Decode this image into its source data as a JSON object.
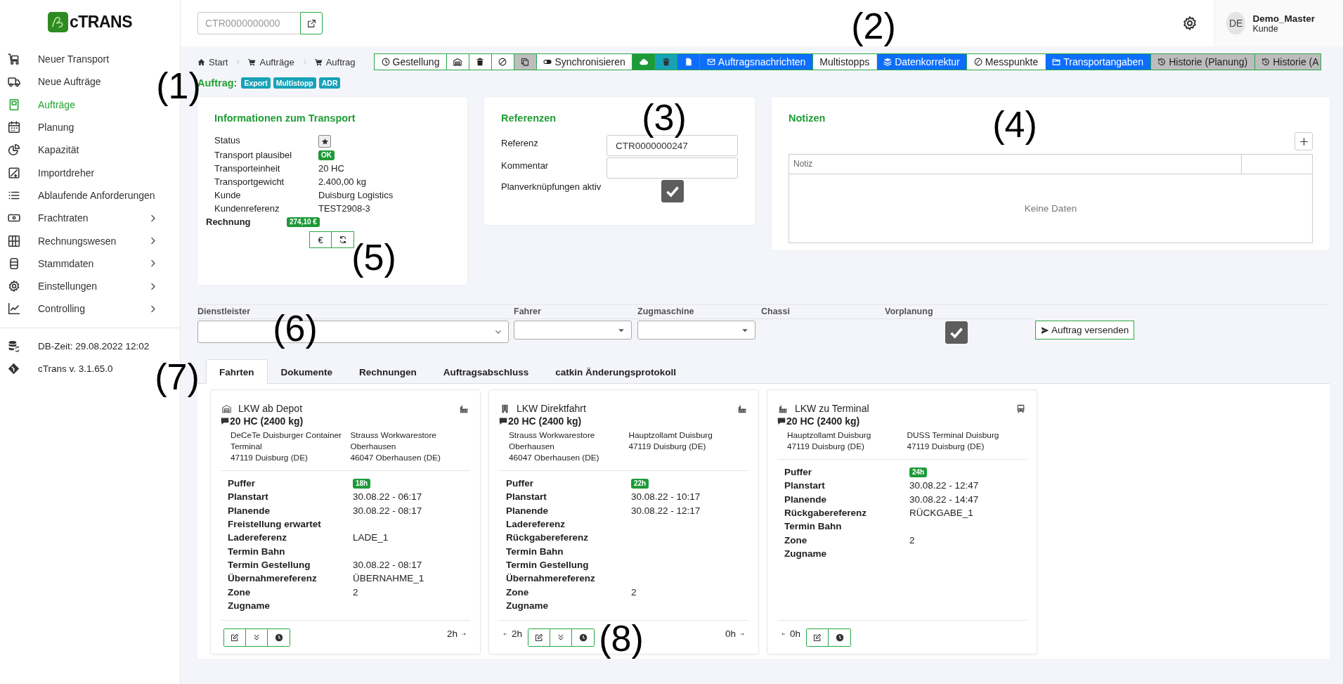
{
  "sidebar": {
    "logo": "cTRANS",
    "items": [
      {
        "label": "Neuer Transport",
        "selected": false,
        "submenu": false
      },
      {
        "label": "Neue Aufträge",
        "selected": false,
        "submenu": false
      },
      {
        "label": "Aufträge",
        "selected": true,
        "submenu": false
      },
      {
        "label": "Planung",
        "selected": false,
        "submenu": false
      },
      {
        "label": "Kapazität",
        "selected": false,
        "submenu": false
      },
      {
        "label": "Importdreher",
        "selected": false,
        "submenu": false
      },
      {
        "label": "Ablaufende Anforderungen",
        "selected": false,
        "submenu": false
      },
      {
        "label": "Frachtraten",
        "selected": false,
        "submenu": true
      },
      {
        "label": "Rechnungswesen",
        "selected": false,
        "submenu": true
      },
      {
        "label": "Stammdaten",
        "selected": false,
        "submenu": true
      },
      {
        "label": "Einstellungen",
        "selected": false,
        "submenu": true
      },
      {
        "label": "Controlling",
        "selected": false,
        "submenu": true
      }
    ],
    "footer": [
      "DB-Zeit: 29.08.2022 12:02",
      "cTrans v. 3.1.65.0"
    ]
  },
  "header": {
    "search": {
      "placeholder": "CTR0000000000"
    },
    "user": {
      "initials": "DE",
      "name": "Demo_Master",
      "role": "Kunde"
    }
  },
  "breadcrumb": [
    "Start",
    "Aufträge",
    "Auftrag"
  ],
  "toolbar": [
    {
      "label": "Gestellung",
      "kind": "outline"
    },
    {
      "kind": "outline"
    },
    {
      "kind": "outline"
    },
    {
      "kind": "outline"
    },
    {
      "kind": "gray"
    },
    {
      "label": "Synchronisieren",
      "kind": "outline"
    },
    {
      "kind": "green"
    },
    {
      "kind": "teal"
    },
    {
      "kind": "blue"
    },
    {
      "label": "Auftragsnachrichten",
      "kind": "blue"
    },
    {
      "label": "Multistopps",
      "kind": "plain"
    },
    {
      "label": "Datenkorrektur",
      "kind": "blue"
    },
    {
      "label": "Messpunkte",
      "kind": "plain"
    },
    {
      "label": "Transportangaben",
      "kind": "blue"
    },
    {
      "label": "Historie (Planung)",
      "kind": "gray"
    },
    {
      "label": "Historie (A",
      "kind": "gray"
    }
  ],
  "order": {
    "title": "Auftrag:",
    "tags": [
      "Export",
      "Multistopp",
      "ADR"
    ]
  },
  "transport_info": {
    "title": "Informationen zum Transport",
    "rows": [
      {
        "label": "Status",
        "kind": "star"
      },
      {
        "label": "Transport plausibel",
        "kind": "badge",
        "value": "OK"
      },
      {
        "label": "Transporteinheit",
        "kind": "text",
        "value": "20 HC"
      },
      {
        "label": "Transportgewicht",
        "kind": "text",
        "value": "2.400,00 kg"
      },
      {
        "label": "Kunde",
        "kind": "text",
        "value": "Duisburg Logistics"
      },
      {
        "label": "Kundenreferenz",
        "kind": "text",
        "value": "TEST2908-3"
      }
    ],
    "invoice": {
      "label": "Rechnung",
      "badge": "274,10 €",
      "currency_button": "€"
    }
  },
  "references": {
    "title": "Referenzen",
    "fields": [
      {
        "label": "Referenz",
        "value": "CTR0000000247"
      },
      {
        "label": "Kommentar"
      }
    ],
    "plan_links": {
      "label": "Planverknüpfungen aktiv",
      "checked": true
    }
  },
  "notes": {
    "title": "Notizen",
    "columns": [
      "Notiz"
    ],
    "empty_text": "Keine Daten"
  },
  "assignment": {
    "fields": [
      {
        "label": "Dienstleister",
        "kind": "wide-select"
      },
      {
        "label": "Fahrer",
        "kind": "select"
      },
      {
        "label": "Zugmaschine",
        "kind": "select"
      },
      {
        "label": "Chassi",
        "kind": "none"
      },
      {
        "label": "Vorplanung",
        "kind": "checkbox",
        "checked": true
      }
    ],
    "send_button": "Auftrag versenden"
  },
  "tabs": [
    {
      "label": "Fahrten",
      "selected": true
    },
    {
      "label": "Dokumente",
      "selected": false
    },
    {
      "label": "Rechnungen",
      "selected": false
    },
    {
      "label": "Auftragsabschluss",
      "selected": false
    },
    {
      "label": "catkin Änderungsprotokoll",
      "selected": false
    }
  ],
  "trips": [
    {
      "title": "LKW ab Depot",
      "cargo": "20 HC (2400 kg)",
      "from": {
        "name": "DeCeTe Duisburger Container Terminal",
        "city": "47119 Duisburg (DE)"
      },
      "to": {
        "name": "Strauss Workwarestore Oberhausen",
        "city": "46047 Oberhausen (DE)"
      },
      "details": [
        {
          "label": "Puffer",
          "badge": "18h"
        },
        {
          "label": "Planstart",
          "value": "30.08.22 - 06:17"
        },
        {
          "label": "Planende",
          "value": "30.08.22 - 08:17"
        },
        {
          "label": "Freistellung erwartet"
        },
        {
          "label": "Ladereferenz",
          "value": "LADE_1"
        },
        {
          "label": "Termin Bahn"
        },
        {
          "label": "Termin Gestellung",
          "value": "30.08.22 - 08:17"
        },
        {
          "label": "Übernahmereferenz",
          "value": "ÜBERNAHME_1"
        },
        {
          "label": "Zone",
          "value": "2"
        },
        {
          "label": "Zugname"
        }
      ],
      "footer": {
        "actions": [
          {
            "kind": "edit"
          },
          {
            "kind": "expand"
          },
          {
            "kind": "clock"
          }
        ],
        "next_duration": "2h"
      }
    },
    {
      "title": "LKW Direktfahrt",
      "cargo": "20 HC (2400 kg)",
      "from": {
        "name": "Strauss Workwarestore Oberhausen",
        "city": "46047 Oberhausen (DE)"
      },
      "to": {
        "name": "Hauptzollamt Duisburg",
        "city": "47119 Duisburg (DE)"
      },
      "details": [
        {
          "label": "Puffer",
          "badge": "22h"
        },
        {
          "label": "Planstart",
          "value": "30.08.22 - 10:17"
        },
        {
          "label": "Planende",
          "value": "30.08.22 - 12:17"
        },
        {
          "label": "Ladereferenz"
        },
        {
          "label": "Rückgabereferenz"
        },
        {
          "label": "Termin Bahn"
        },
        {
          "label": "Termin Gestellung"
        },
        {
          "label": "Übernahmereferenz"
        },
        {
          "label": "Zone",
          "value": "2"
        },
        {
          "label": "Zugname"
        }
      ],
      "footer": {
        "prev_duration": "2h",
        "actions": [
          {
            "kind": "edit"
          },
          {
            "kind": "expand"
          },
          {
            "kind": "clock"
          }
        ],
        "next_duration": "0h"
      }
    },
    {
      "title": "LKW zu Terminal",
      "cargo": "20 HC (2400 kg)",
      "from": {
        "name": "Hauptzollamt Duisburg",
        "city": "47119 Duisburg (DE)"
      },
      "to": {
        "name": "DUSS Terminal Duisburg",
        "city": "47119 Duisburg (DE)"
      },
      "details": [
        {
          "label": "Puffer",
          "badge": "24h"
        },
        {
          "label": "Planstart",
          "value": "30.08.22 - 12:47"
        },
        {
          "label": "Planende",
          "value": "30.08.22 - 14:47"
        },
        {
          "label": "Rückgabereferenz",
          "value": "RÜCKGABE_1"
        },
        {
          "label": "Termin Bahn"
        },
        {
          "label": "Zone",
          "value": "2"
        },
        {
          "label": "Zugname"
        }
      ],
      "footer": {
        "prev_duration": "0h",
        "actions": [
          {
            "kind": "edit"
          },
          {
            "kind": "clock"
          }
        ]
      }
    }
  ],
  "callouts": [
    "(1)",
    "(2)",
    "(3)",
    "(4)",
    "(5)",
    "(6)",
    "(7)",
    "(8)"
  ]
}
